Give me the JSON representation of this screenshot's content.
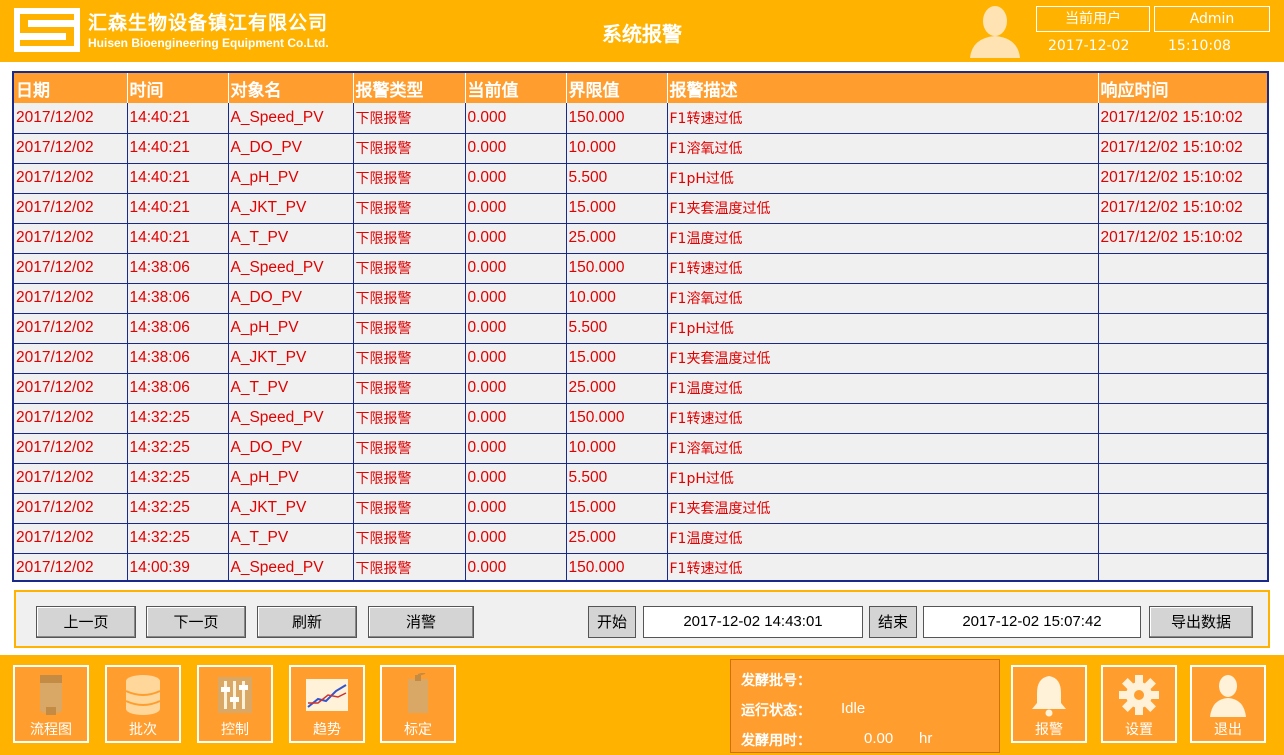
{
  "header": {
    "company_cn": "汇森生物设备镇江有限公司",
    "company_en": "Huisen Bioengineering Equipment Co.Ltd.",
    "page_title": "系统报警",
    "user_label": "当前用户",
    "user_name": "Admin",
    "date": "2017-12-02",
    "time": "15:10:08"
  },
  "table": {
    "columns": [
      "日期",
      "时间",
      "对象名",
      "报警类型",
      "当前值",
      "界限值",
      "报警描述",
      "响应时间"
    ],
    "rows": [
      [
        "2017/12/02",
        "14:40:21",
        "A_Speed_PV",
        "下限报警",
        "0.000",
        "150.000",
        "F1转速过低",
        "2017/12/02 15:10:02"
      ],
      [
        "2017/12/02",
        "14:40:21",
        "A_DO_PV",
        "下限报警",
        "0.000",
        "10.000",
        "F1溶氧过低",
        "2017/12/02 15:10:02"
      ],
      [
        "2017/12/02",
        "14:40:21",
        "A_pH_PV",
        "下限报警",
        "0.000",
        "5.500",
        "F1pH过低",
        "2017/12/02 15:10:02"
      ],
      [
        "2017/12/02",
        "14:40:21",
        "A_JKT_PV",
        "下限报警",
        "0.000",
        "15.000",
        "F1夹套温度过低",
        "2017/12/02 15:10:02"
      ],
      [
        "2017/12/02",
        "14:40:21",
        "A_T_PV",
        "下限报警",
        "0.000",
        "25.000",
        "F1温度过低",
        "2017/12/02 15:10:02"
      ],
      [
        "2017/12/02",
        "14:38:06",
        "A_Speed_PV",
        "下限报警",
        "0.000",
        "150.000",
        "F1转速过低",
        ""
      ],
      [
        "2017/12/02",
        "14:38:06",
        "A_DO_PV",
        "下限报警",
        "0.000",
        "10.000",
        "F1溶氧过低",
        ""
      ],
      [
        "2017/12/02",
        "14:38:06",
        "A_pH_PV",
        "下限报警",
        "0.000",
        "5.500",
        "F1pH过低",
        ""
      ],
      [
        "2017/12/02",
        "14:38:06",
        "A_JKT_PV",
        "下限报警",
        "0.000",
        "15.000",
        "F1夹套温度过低",
        ""
      ],
      [
        "2017/12/02",
        "14:38:06",
        "A_T_PV",
        "下限报警",
        "0.000",
        "25.000",
        "F1温度过低",
        ""
      ],
      [
        "2017/12/02",
        "14:32:25",
        "A_Speed_PV",
        "下限报警",
        "0.000",
        "150.000",
        "F1转速过低",
        ""
      ],
      [
        "2017/12/02",
        "14:32:25",
        "A_DO_PV",
        "下限报警",
        "0.000",
        "10.000",
        "F1溶氧过低",
        ""
      ],
      [
        "2017/12/02",
        "14:32:25",
        "A_pH_PV",
        "下限报警",
        "0.000",
        "5.500",
        "F1pH过低",
        ""
      ],
      [
        "2017/12/02",
        "14:32:25",
        "A_JKT_PV",
        "下限报警",
        "0.000",
        "15.000",
        "F1夹套温度过低",
        ""
      ],
      [
        "2017/12/02",
        "14:32:25",
        "A_T_PV",
        "下限报警",
        "0.000",
        "25.000",
        "F1温度过低",
        ""
      ],
      [
        "2017/12/02",
        "14:00:39",
        "A_Speed_PV",
        "下限报警",
        "0.000",
        "150.000",
        "F1转速过低",
        ""
      ]
    ]
  },
  "controls": {
    "prev_page": "上一页",
    "next_page": "下一页",
    "refresh": "刷新",
    "acknowledge": "消警",
    "start_label": "开始",
    "start_value": "2017-12-02 14:43:01",
    "end_label": "结束",
    "end_value": "2017-12-02 15:07:42",
    "export": "导出数据"
  },
  "footer": {
    "nav": [
      {
        "label": "流程图",
        "icon": "vessel-icon"
      },
      {
        "label": "批次",
        "icon": "database-icon"
      },
      {
        "label": "控制",
        "icon": "sliders-icon"
      },
      {
        "label": "趋势",
        "icon": "trend-chart-icon"
      },
      {
        "label": "标定",
        "icon": "calibration-icon"
      }
    ],
    "status": {
      "batch_label": "发酵批号：",
      "batch_value": "",
      "run_label": "运行状态：",
      "run_value": "Idle",
      "time_label": "发酵用时：",
      "time_value": "0.00",
      "time_unit": "hr"
    },
    "actions": [
      {
        "label": "报警",
        "icon": "bell-icon"
      },
      {
        "label": "设置",
        "icon": "gear-icon"
      },
      {
        "label": "退出",
        "icon": "user-exit-icon"
      }
    ]
  },
  "colors": {
    "header_bg": "#ffb300",
    "header_cell_bg": "#ff9e2f",
    "alarm_text": "#e00000",
    "table_border": "#1a2a8a"
  }
}
